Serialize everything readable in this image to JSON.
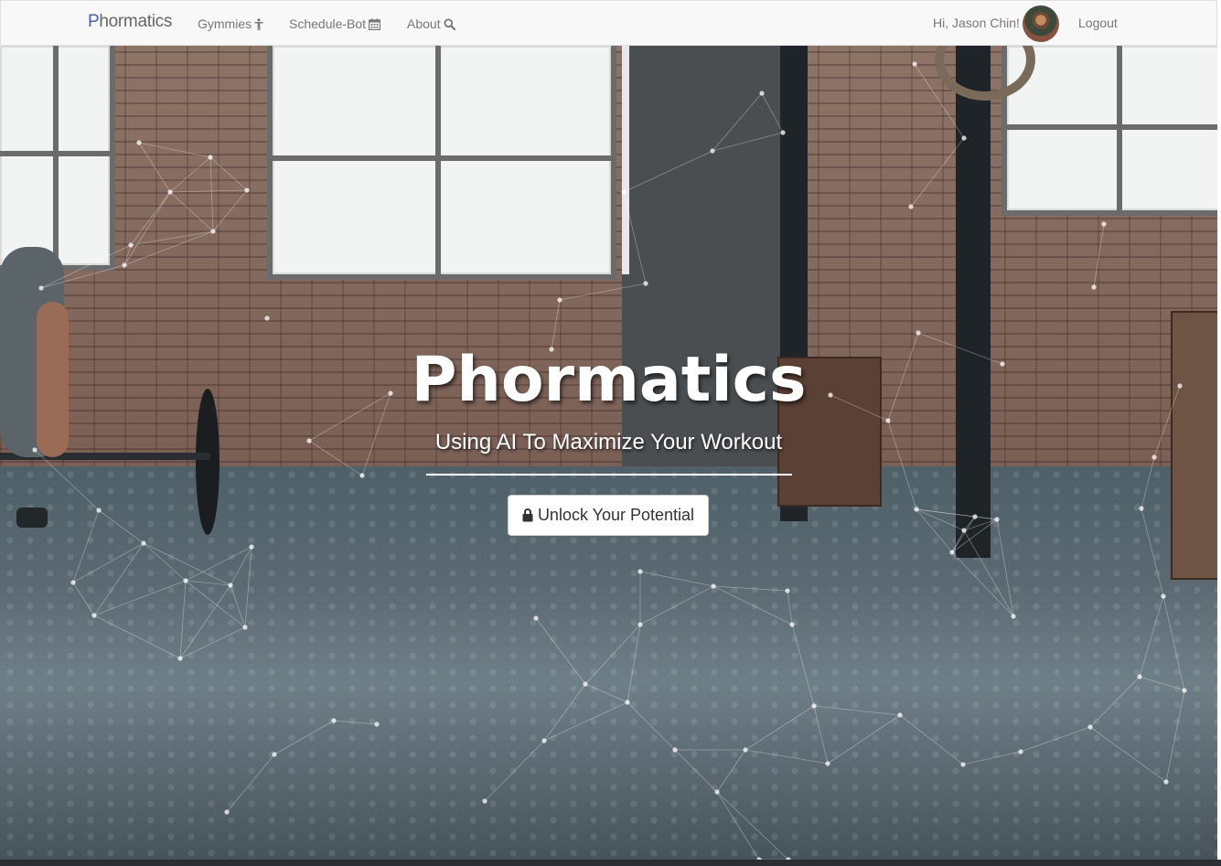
{
  "brand": {
    "first_letter": "P",
    "rest": "hormatics"
  },
  "nav": {
    "items": [
      {
        "label": "Gymmies",
        "icon": "fitness-figure-icon"
      },
      {
        "label": "Schedule-Bot",
        "icon": "calendar-icon"
      },
      {
        "label": "About",
        "icon": "search-icon"
      }
    ],
    "greeting": "Hi, Jason Chin!",
    "logout": "Logout"
  },
  "hero": {
    "title": "Phormatics",
    "subtitle": "Using AI To Maximize Your Workout",
    "cta_label": "Unlock Your Potential",
    "cta_icon": "lock-icon"
  },
  "colors": {
    "navbar_bg": "#f8f8f8",
    "nav_text": "#777777",
    "brand_accent": "#4a5fb0",
    "hero_text": "#ffffff"
  }
}
